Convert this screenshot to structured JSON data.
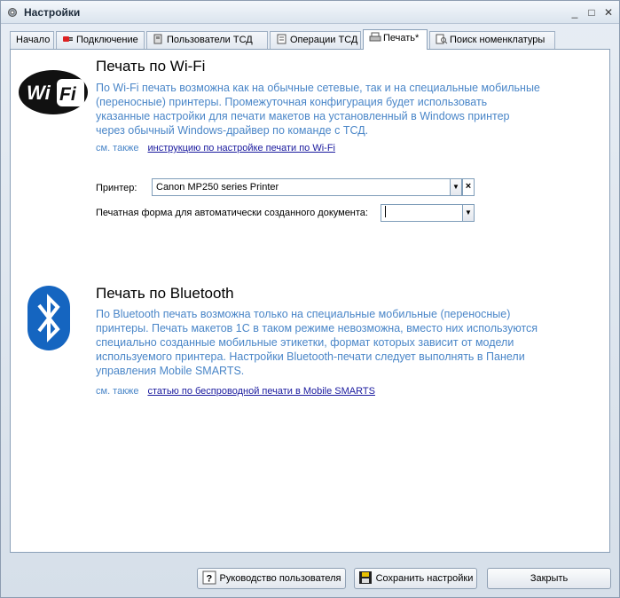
{
  "window": {
    "title": "Настройки"
  },
  "tabs": [
    {
      "label": "Начало",
      "icon": "none"
    },
    {
      "label": "Подключение",
      "icon": "plug-icon"
    },
    {
      "label": "Пользователи ТСД",
      "icon": "users-icon"
    },
    {
      "label": "Операции ТСД",
      "icon": "operations-icon"
    },
    {
      "label": "Печать*",
      "icon": "printer-icon"
    },
    {
      "label": "Поиск номенклатуры",
      "icon": "search-doc-icon"
    }
  ],
  "wifi": {
    "title": "Печать по Wi-Fi",
    "logo_text": "Wi Fi",
    "desc": [
      "По Wi-Fi печать возможна как на обычные сетевые, так и на специальные мобильные",
      "(переносные) принтеры.  Промежуточная конфигурация будет использовать",
      "указанные настройки для печати макетов на установленный в Windows принтер",
      "через обычный Windows-драйвер по команде с ТСД."
    ],
    "see_also": "см. также",
    "link": "инструкцию по настройке печати по Wi-Fi",
    "printer_label": "Принтер:",
    "printer_value": "Canon MP250 series Printer",
    "form_label": "Печатная форма для автоматически созданного документа:",
    "form_value": ""
  },
  "bluetooth": {
    "title": "Печать по Bluetooth",
    "desc": [
      "По Bluetooth печать возможна только на специальные мобильные (переносные)",
      "принтеры.  Печать макетов 1С в таком режиме невозможна, вместо них используются",
      "специально созданные мобильные этикетки, формат которых зависит от модели",
      "используемого принтера.  Настройки Bluetooth-печати следует выполнять в Панели",
      "управления Mobile SMARTS."
    ],
    "see_also": "см. также",
    "link": "статью по беспроводной печати в Mobile SMARTS"
  },
  "footer": {
    "help_label": "Руководство пользователя",
    "save_label": "Сохранить настройки",
    "close_label": "Закрыть"
  },
  "colors": {
    "accent_text": "#4a86c8",
    "link": "#1a1a9e",
    "bluetooth": "#1565c0"
  }
}
